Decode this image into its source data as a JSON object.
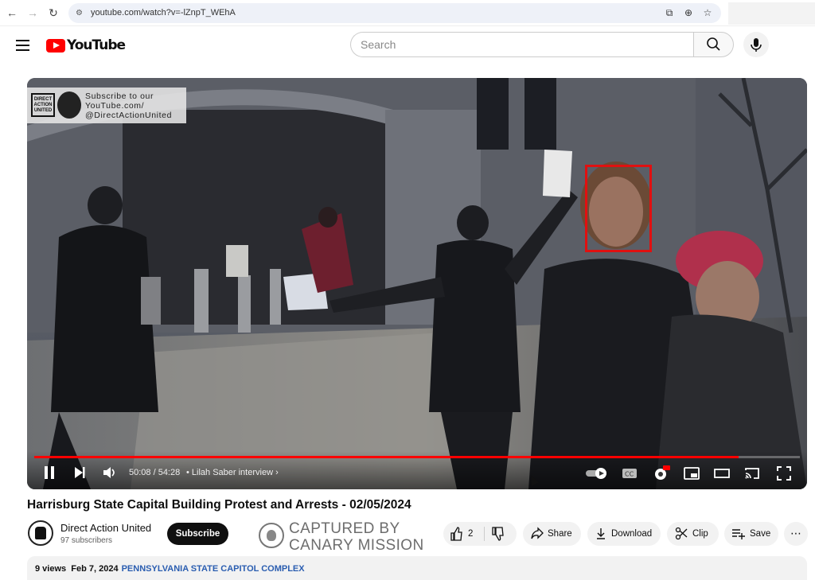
{
  "browser": {
    "url": "youtube.com/watch?v=-lZnpT_WEhA",
    "back_icon": "arrow-left-icon",
    "forward_icon": "arrow-right-icon",
    "reload_icon": "reload-icon"
  },
  "header": {
    "logo_text": "YouTube",
    "search_placeholder": "Search"
  },
  "video": {
    "overlay_logo_text": "DIRECT ACTION UNITED",
    "overlay_text_line1": "Subscribe to our",
    "overlay_text_line2": "YouTube.com/",
    "overlay_text_line3": "@DirectActionUnited",
    "time": "50:08 / 54:28",
    "chapter": "• Lilah Saber interview",
    "progress": 0.92,
    "hd_badge": "HD"
  },
  "info": {
    "title": "Harrisburg State Capital Building Protest and Arrests - 02/05/2024",
    "channel_name": "Direct Action United",
    "subscribers": "97 subscribers",
    "subscribe_label": "Subscribe",
    "watermark_line1": "CAPTURED BY",
    "watermark_line2": "CANARY MISSION",
    "like_count": "2",
    "share_label": "Share",
    "download_label": "Download",
    "clip_label": "Clip",
    "save_label": "Save"
  },
  "description": {
    "views": "9 views",
    "date": "Feb 7, 2024",
    "tag": "PENNSYLVANIA STATE CAPITOL COMPLEX"
  },
  "colors": {
    "brand_red": "#ff0000",
    "progress_red": "#ff0000",
    "face_box": "#e01010",
    "tag_blue": "#2a5db0"
  }
}
